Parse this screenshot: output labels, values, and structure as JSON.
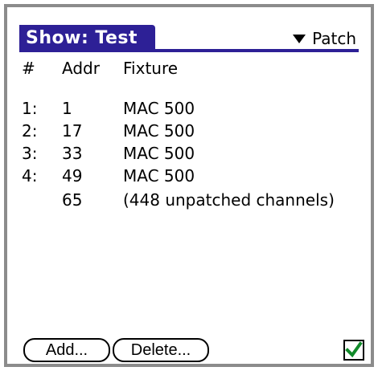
{
  "title": "Show: Test",
  "menu": {
    "label": "Patch",
    "icon": "dropdown-triangle-icon"
  },
  "columns": {
    "num": "#",
    "addr": "Addr",
    "fixture": "Fixture"
  },
  "rows": [
    {
      "num": "1:",
      "addr": "1",
      "fixture": "MAC 500"
    },
    {
      "num": "2:",
      "addr": "17",
      "fixture": "MAC 500"
    },
    {
      "num": "3:",
      "addr": "33",
      "fixture": "MAC 500"
    },
    {
      "num": "4:",
      "addr": "49",
      "fixture": "MAC 500"
    },
    {
      "num": "",
      "addr": "65",
      "fixture": "(448 unpatched channels)"
    }
  ],
  "buttons": {
    "add": "Add...",
    "delete": "Delete..."
  },
  "checkbox": {
    "checked": true,
    "icon": "checkmark-icon",
    "check_color": "#118a2a"
  },
  "colors": {
    "title_bar": "#2d2096",
    "frame_border": "#8c8c8c"
  }
}
